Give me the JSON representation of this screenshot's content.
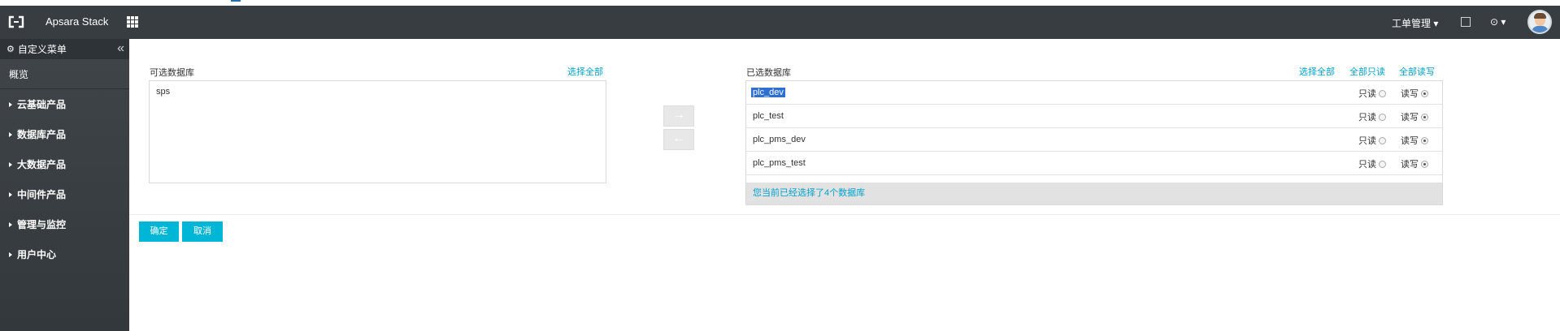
{
  "header": {
    "brand": "Apsara Stack",
    "ticket_menu": "工单管理 ▾",
    "help_menu": "⊙ ▾"
  },
  "sidebar": {
    "title": "自定义菜单",
    "collapse_glyph": "«",
    "overview": "概览",
    "items": [
      {
        "label": "云基础产品"
      },
      {
        "label": "数据库产品"
      },
      {
        "label": "大数据产品"
      },
      {
        "label": "中间件产品"
      },
      {
        "label": "管理与监控"
      },
      {
        "label": "用户中心"
      }
    ]
  },
  "available": {
    "title": "可选数据库",
    "select_all": "选择全部",
    "items": [
      "sps"
    ]
  },
  "transfer": {
    "to_right": "→",
    "to_left": "←"
  },
  "selected": {
    "title": "已选数据库",
    "select_all": "选择全部",
    "all_readonly": "全部只读",
    "all_readwrite": "全部读写",
    "readonly_label": "只读",
    "readwrite_label": "读写",
    "rows": [
      {
        "name": "plc_dev",
        "mode": "readwrite",
        "highlighted": true
      },
      {
        "name": "plc_test",
        "mode": "readwrite",
        "highlighted": false
      },
      {
        "name": "plc_pms_dev",
        "mode": "readwrite",
        "highlighted": false
      },
      {
        "name": "plc_pms_test",
        "mode": "readwrite",
        "highlighted": false
      }
    ],
    "summary": "您当前已经选择了4个数据库"
  },
  "actions": {
    "confirm": "确定",
    "cancel": "取消"
  },
  "colors": {
    "topbar": "#373d41",
    "sidebar": "#3f4548",
    "accent": "#00b6d6",
    "link": "#00a2ca"
  }
}
